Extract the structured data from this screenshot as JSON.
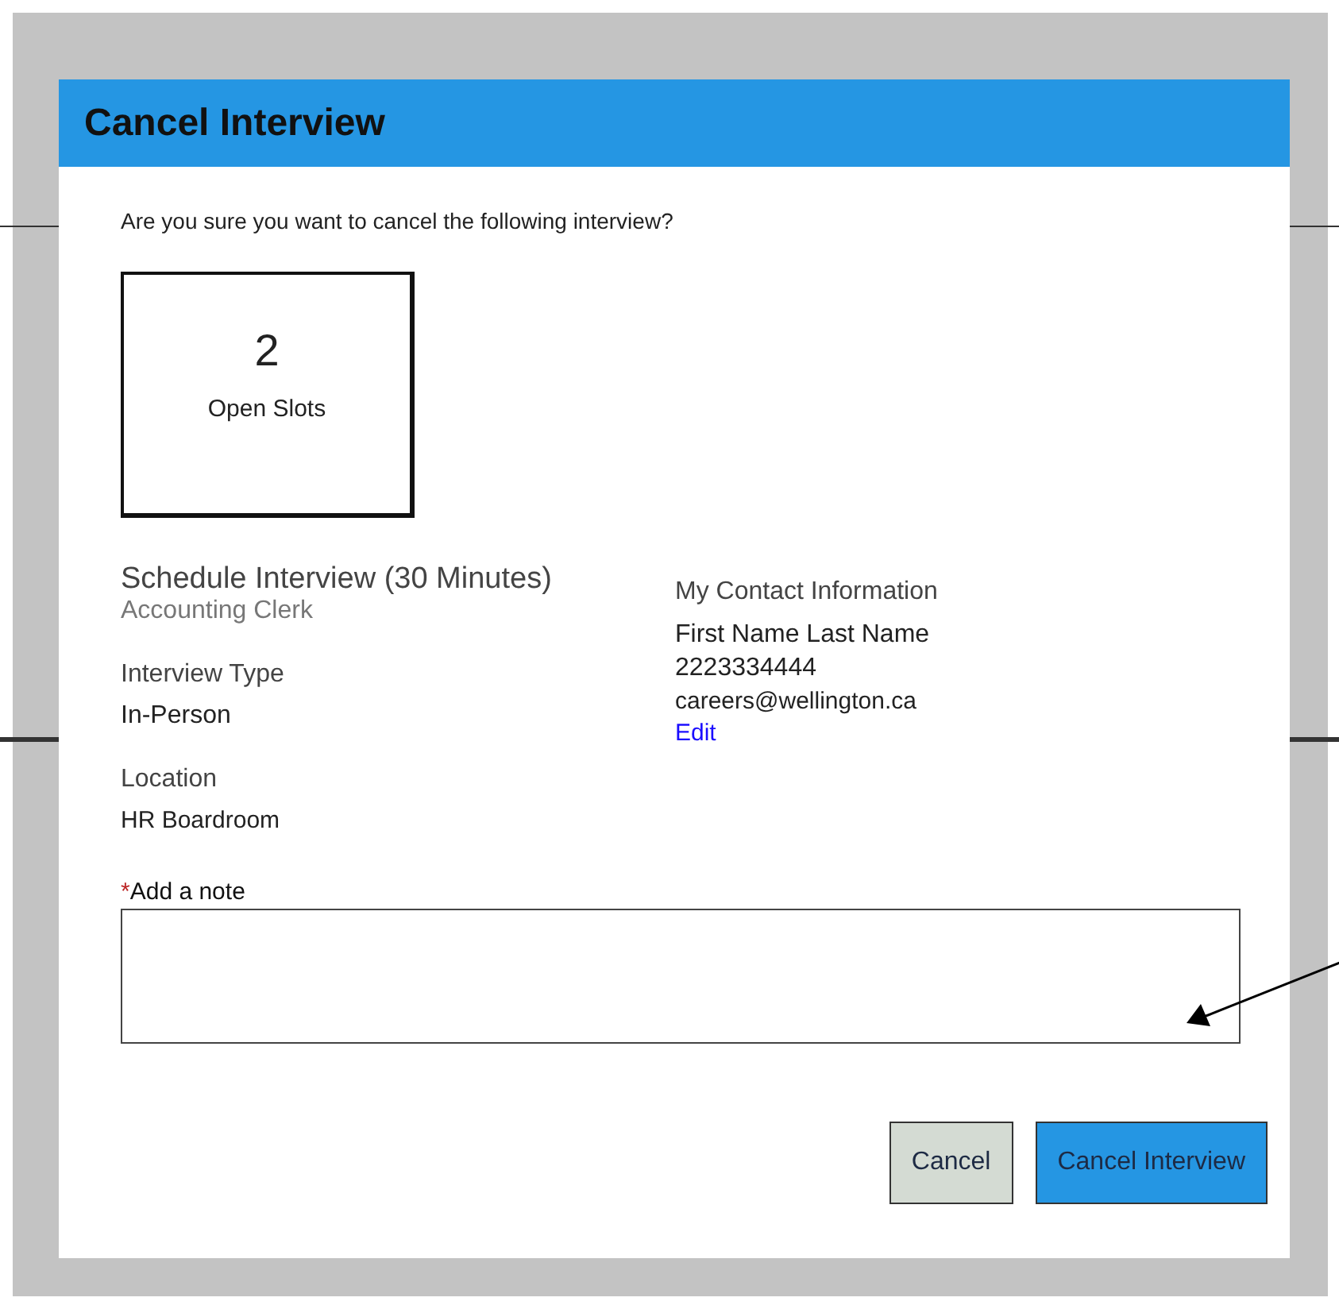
{
  "dialog": {
    "title": "Cancel Interview",
    "prompt": "Are you sure you want to cancel the following interview?"
  },
  "slots": {
    "count": "2",
    "label": "Open Slots"
  },
  "schedule": {
    "title": "Schedule Interview (30 Minutes)",
    "position": "Accounting Clerk"
  },
  "details": [
    {
      "label": "Interview Type",
      "value": "In-Person"
    },
    {
      "label": "Location",
      "value": "HR Boardroom"
    }
  ],
  "contact": {
    "heading": "My Contact Information",
    "name": "First Name Last Name",
    "phone": "2223334444",
    "email": "careers@wellington.ca",
    "edit_link": "Edit"
  },
  "note": {
    "label": "Add a note",
    "required": true,
    "required_mark": "*"
  },
  "buttons": [
    {
      "label": "Cancel",
      "kind": "secondary"
    },
    {
      "label": "Cancel Interview",
      "kind": "primary"
    }
  ]
}
